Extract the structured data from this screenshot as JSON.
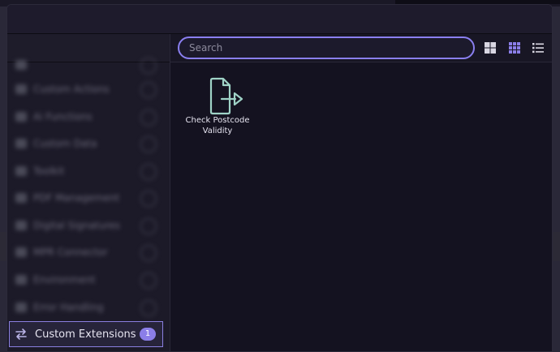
{
  "sidebar": {
    "blurred_items": [
      {
        "label": "Custom Actions"
      },
      {
        "label": "Ai Functions"
      },
      {
        "label": "Custom Data"
      },
      {
        "label": "Toolkit"
      },
      {
        "label": "PDF Management"
      },
      {
        "label": "Digital Signatures"
      },
      {
        "label": "MPR Connector"
      },
      {
        "label": "Environment"
      },
      {
        "label": "Error Handling"
      }
    ],
    "selected": {
      "label": "Custom Extensions",
      "count": "1"
    }
  },
  "toolbar": {
    "search_placeholder": "Search"
  },
  "items": [
    {
      "label": "Check Postcode Validity",
      "icon": "document-export-icon"
    }
  ],
  "colors": {
    "accent": "#8a7ff0",
    "tile_icon": "#9fd3c7",
    "background": "#141220"
  }
}
